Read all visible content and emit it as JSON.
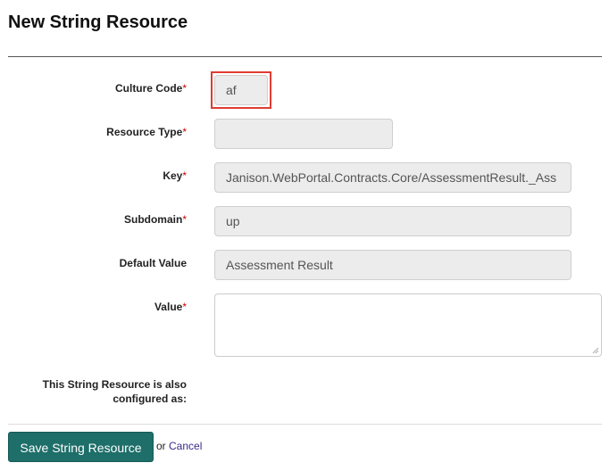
{
  "page": {
    "title": "New String Resource"
  },
  "form": {
    "required_marker": "*",
    "culture_code": {
      "label": "Culture Code",
      "value": "af"
    },
    "resource_type": {
      "label": "Resource Type",
      "value": ""
    },
    "key": {
      "label": "Key",
      "value": "Janison.WebPortal.Contracts.Core/AssessmentResult._Ass"
    },
    "subdomain": {
      "label": "Subdomain",
      "value": "up"
    },
    "default_value": {
      "label": "Default Value",
      "value": "Assessment Result"
    },
    "value": {
      "label": "Value",
      "value": ""
    },
    "configured_as": {
      "line1": "This String Resource is also",
      "line2": "configured as:"
    }
  },
  "actions": {
    "save_label": "Save String Resource",
    "or_text": "or",
    "cancel_label": "Cancel"
  },
  "colors": {
    "save_button": "#1e6e69",
    "highlight": "#e03c31",
    "required": "#cc0000",
    "cancel_link": "#3b2a8a"
  }
}
